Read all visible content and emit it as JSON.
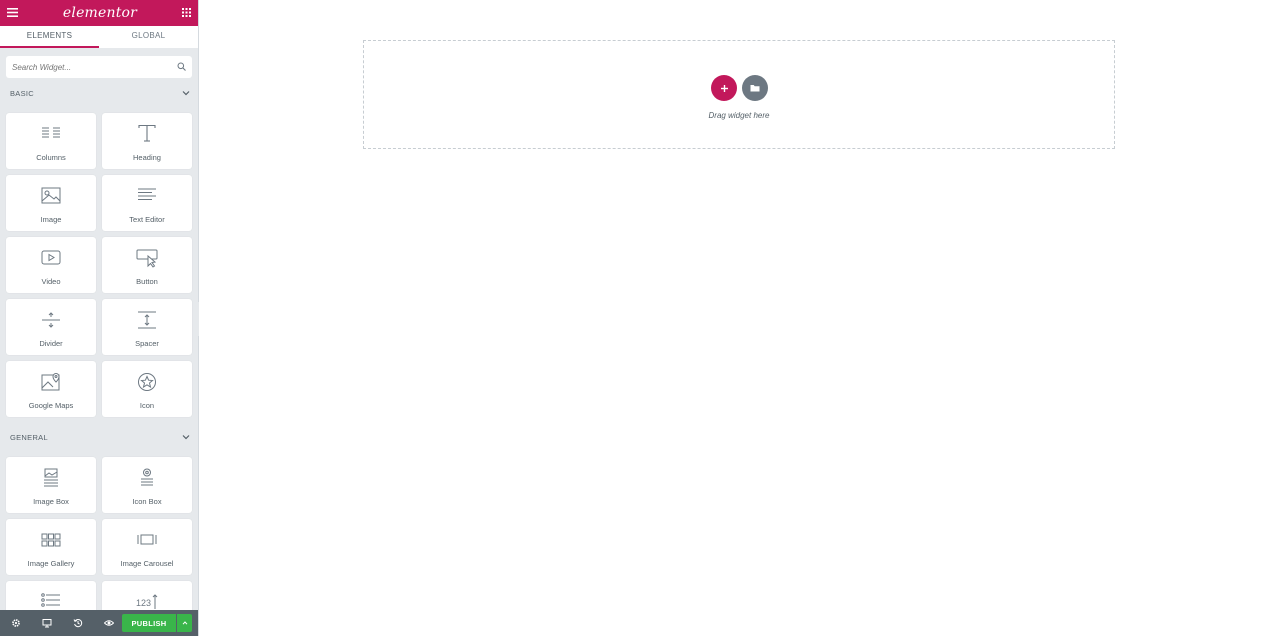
{
  "header": {
    "logo_text": "elementor",
    "menu_icon": "hamburger-icon",
    "apps_icon": "grid-icon"
  },
  "tabs": [
    {
      "label": "ELEMENTS",
      "active": true
    },
    {
      "label": "GLOBAL",
      "active": false
    }
  ],
  "search": {
    "placeholder": "Search Widget...",
    "value": "",
    "icon": "search-icon"
  },
  "sections": {
    "basic": {
      "title": "BASIC",
      "widgets": [
        {
          "label": "Columns",
          "icon": "columns-icon"
        },
        {
          "label": "Heading",
          "icon": "heading-icon"
        },
        {
          "label": "Image",
          "icon": "image-icon"
        },
        {
          "label": "Text Editor",
          "icon": "text-editor-icon"
        },
        {
          "label": "Video",
          "icon": "video-icon"
        },
        {
          "label": "Button",
          "icon": "button-icon"
        },
        {
          "label": "Divider",
          "icon": "divider-icon"
        },
        {
          "label": "Spacer",
          "icon": "spacer-icon"
        },
        {
          "label": "Google Maps",
          "icon": "google-maps-icon"
        },
        {
          "label": "Icon",
          "icon": "star-icon"
        }
      ]
    },
    "general": {
      "title": "GENERAL",
      "widgets": [
        {
          "label": "Image Box",
          "icon": "image-box-icon"
        },
        {
          "label": "Icon Box",
          "icon": "icon-box-icon"
        },
        {
          "label": "Image Gallery",
          "icon": "image-gallery-icon"
        },
        {
          "label": "Image Carousel",
          "icon": "image-carousel-icon"
        },
        {
          "label": "",
          "icon": "icon-list-icon"
        },
        {
          "label": "",
          "icon": "counter-icon",
          "glyph": "123"
        }
      ]
    }
  },
  "footer": {
    "buttons": [
      "settings-icon",
      "responsive-icon",
      "history-icon",
      "preview-icon"
    ],
    "publish_label": "PUBLISH"
  },
  "canvas": {
    "drop_text": "Drag widget here"
  },
  "colors": {
    "brand": "#c2185b",
    "publish": "#39b54a",
    "panel_bg": "#e6e9ec",
    "footer_bg": "#556068",
    "template_button": "#6d7882"
  }
}
